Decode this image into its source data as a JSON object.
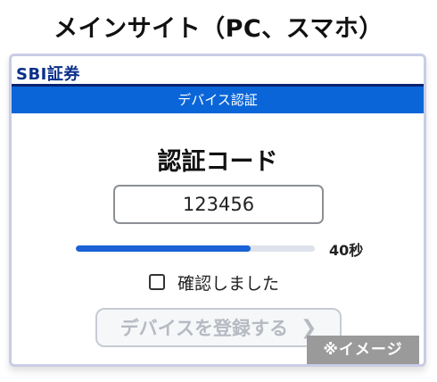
{
  "heading": "メインサイト（PC、スマホ）",
  "brand": "SBI証券",
  "titlebar": "デバイス認証",
  "code_title": "認証コード",
  "code_value": "123456",
  "timer": {
    "label": "40秒",
    "remaining_fraction": 0.73
  },
  "confirm": {
    "label": "確認しました",
    "checked": false
  },
  "register_button": {
    "label": "デバイスを登録する",
    "enabled": false
  },
  "image_tag": "※イメージ",
  "colors": {
    "brand": "#0b2f8a",
    "titlebar": "#0a66d8",
    "progress": "#1a62d6"
  }
}
